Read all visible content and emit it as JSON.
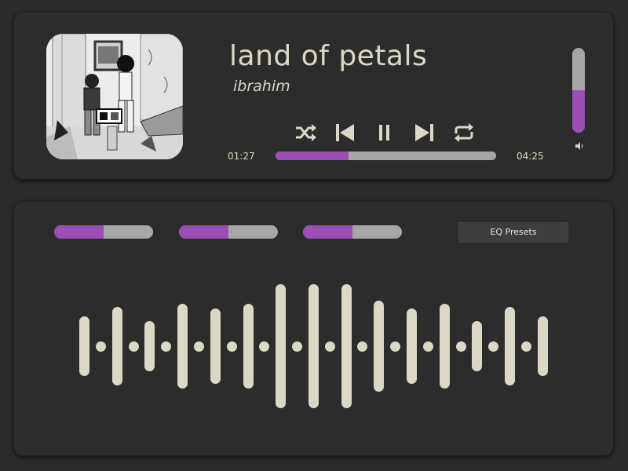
{
  "track": {
    "title": "land of petals",
    "artist": "ibrahim",
    "elapsed": "01:27",
    "duration": "04:25",
    "progress_fraction": 0.33
  },
  "controls": [
    {
      "name": "shuffle-icon"
    },
    {
      "name": "previous-icon"
    },
    {
      "name": "pause-icon"
    },
    {
      "name": "next-icon"
    },
    {
      "name": "repeat-icon"
    }
  ],
  "volume": {
    "level_fraction": 0.5,
    "icon": "speaker-icon"
  },
  "album_art": {
    "icon": "album-art-image"
  },
  "equalizer": {
    "sliders": [
      {
        "level_fraction": 0.5
      },
      {
        "level_fraction": 0.5
      },
      {
        "level_fraction": 0.5
      }
    ],
    "presets_label": "EQ Presets"
  },
  "waveform": {
    "bar_heights": [
      76,
      100,
      64,
      108,
      96,
      108,
      158,
      158,
      158,
      116,
      96,
      108,
      64,
      100,
      76
    ]
  },
  "colors": {
    "accent": "#9b4fb6",
    "track": "#a6a6a6",
    "text": "#dcd8c6",
    "panel": "#2c2c2c"
  }
}
